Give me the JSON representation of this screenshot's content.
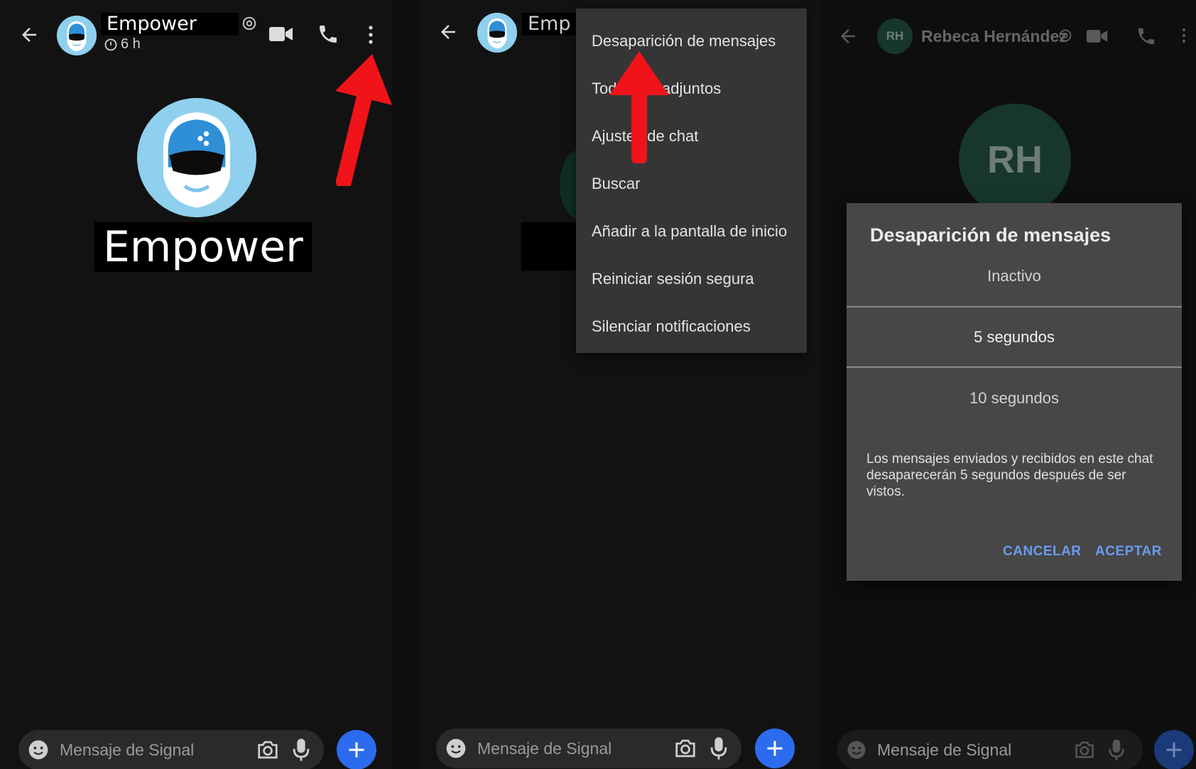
{
  "panel1": {
    "contact_name": "Empower",
    "timer_label": "6 h",
    "profile_name": "Empower",
    "composer_placeholder": "Mensaje de Signal"
  },
  "panel2": {
    "contact_name": "Emp",
    "composer_placeholder": "Mensaje de Signal",
    "menu": [
      "Desaparición de mensajes",
      "Todos los adjuntos",
      "Ajustes de chat",
      "Buscar",
      "Añadir a la pantalla de inicio",
      "Reiniciar sesión segura",
      "Silenciar notificaciones"
    ]
  },
  "panel3": {
    "avatar_initials_small": "RH",
    "contact_name": "Rebeca Hernández",
    "avatar_initials_large": "RH",
    "composer_placeholder": "Mensaje de Signal",
    "dialog": {
      "title": "Desaparición de mensajes",
      "options": [
        "Inactivo",
        "5 segundos",
        "10 segundos"
      ],
      "selected": "5 segundos",
      "description": "Los mensajes enviados y recibidos en este chat desaparecerán 5 segundos después de ser vistos.",
      "cancel": "CANCELAR",
      "accept": "ACEPTAR"
    }
  },
  "colors": {
    "accent": "#2c6bed",
    "arrow": "#f0141a",
    "dialog_button": "#6a9bf0"
  }
}
